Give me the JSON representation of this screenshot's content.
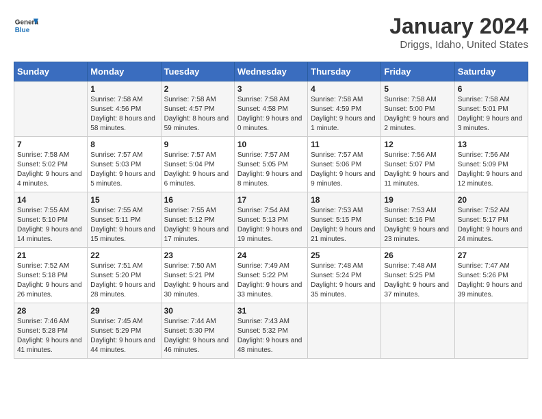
{
  "header": {
    "logo_line1": "General",
    "logo_line2": "Blue",
    "title": "January 2024",
    "subtitle": "Driggs, Idaho, United States"
  },
  "weekdays": [
    "Sunday",
    "Monday",
    "Tuesday",
    "Wednesday",
    "Thursday",
    "Friday",
    "Saturday"
  ],
  "weeks": [
    [
      {
        "day": "",
        "sunrise": "",
        "sunset": "",
        "daylight": ""
      },
      {
        "day": "1",
        "sunrise": "Sunrise: 7:58 AM",
        "sunset": "Sunset: 4:56 PM",
        "daylight": "Daylight: 8 hours and 58 minutes."
      },
      {
        "day": "2",
        "sunrise": "Sunrise: 7:58 AM",
        "sunset": "Sunset: 4:57 PM",
        "daylight": "Daylight: 8 hours and 59 minutes."
      },
      {
        "day": "3",
        "sunrise": "Sunrise: 7:58 AM",
        "sunset": "Sunset: 4:58 PM",
        "daylight": "Daylight: 9 hours and 0 minutes."
      },
      {
        "day": "4",
        "sunrise": "Sunrise: 7:58 AM",
        "sunset": "Sunset: 4:59 PM",
        "daylight": "Daylight: 9 hours and 1 minute."
      },
      {
        "day": "5",
        "sunrise": "Sunrise: 7:58 AM",
        "sunset": "Sunset: 5:00 PM",
        "daylight": "Daylight: 9 hours and 2 minutes."
      },
      {
        "day": "6",
        "sunrise": "Sunrise: 7:58 AM",
        "sunset": "Sunset: 5:01 PM",
        "daylight": "Daylight: 9 hours and 3 minutes."
      }
    ],
    [
      {
        "day": "7",
        "sunrise": "Sunrise: 7:58 AM",
        "sunset": "Sunset: 5:02 PM",
        "daylight": "Daylight: 9 hours and 4 minutes."
      },
      {
        "day": "8",
        "sunrise": "Sunrise: 7:57 AM",
        "sunset": "Sunset: 5:03 PM",
        "daylight": "Daylight: 9 hours and 5 minutes."
      },
      {
        "day": "9",
        "sunrise": "Sunrise: 7:57 AM",
        "sunset": "Sunset: 5:04 PM",
        "daylight": "Daylight: 9 hours and 6 minutes."
      },
      {
        "day": "10",
        "sunrise": "Sunrise: 7:57 AM",
        "sunset": "Sunset: 5:05 PM",
        "daylight": "Daylight: 9 hours and 8 minutes."
      },
      {
        "day": "11",
        "sunrise": "Sunrise: 7:57 AM",
        "sunset": "Sunset: 5:06 PM",
        "daylight": "Daylight: 9 hours and 9 minutes."
      },
      {
        "day": "12",
        "sunrise": "Sunrise: 7:56 AM",
        "sunset": "Sunset: 5:07 PM",
        "daylight": "Daylight: 9 hours and 11 minutes."
      },
      {
        "day": "13",
        "sunrise": "Sunrise: 7:56 AM",
        "sunset": "Sunset: 5:09 PM",
        "daylight": "Daylight: 9 hours and 12 minutes."
      }
    ],
    [
      {
        "day": "14",
        "sunrise": "Sunrise: 7:55 AM",
        "sunset": "Sunset: 5:10 PM",
        "daylight": "Daylight: 9 hours and 14 minutes."
      },
      {
        "day": "15",
        "sunrise": "Sunrise: 7:55 AM",
        "sunset": "Sunset: 5:11 PM",
        "daylight": "Daylight: 9 hours and 15 minutes."
      },
      {
        "day": "16",
        "sunrise": "Sunrise: 7:55 AM",
        "sunset": "Sunset: 5:12 PM",
        "daylight": "Daylight: 9 hours and 17 minutes."
      },
      {
        "day": "17",
        "sunrise": "Sunrise: 7:54 AM",
        "sunset": "Sunset: 5:13 PM",
        "daylight": "Daylight: 9 hours and 19 minutes."
      },
      {
        "day": "18",
        "sunrise": "Sunrise: 7:53 AM",
        "sunset": "Sunset: 5:15 PM",
        "daylight": "Daylight: 9 hours and 21 minutes."
      },
      {
        "day": "19",
        "sunrise": "Sunrise: 7:53 AM",
        "sunset": "Sunset: 5:16 PM",
        "daylight": "Daylight: 9 hours and 23 minutes."
      },
      {
        "day": "20",
        "sunrise": "Sunrise: 7:52 AM",
        "sunset": "Sunset: 5:17 PM",
        "daylight": "Daylight: 9 hours and 24 minutes."
      }
    ],
    [
      {
        "day": "21",
        "sunrise": "Sunrise: 7:52 AM",
        "sunset": "Sunset: 5:18 PM",
        "daylight": "Daylight: 9 hours and 26 minutes."
      },
      {
        "day": "22",
        "sunrise": "Sunrise: 7:51 AM",
        "sunset": "Sunset: 5:20 PM",
        "daylight": "Daylight: 9 hours and 28 minutes."
      },
      {
        "day": "23",
        "sunrise": "Sunrise: 7:50 AM",
        "sunset": "Sunset: 5:21 PM",
        "daylight": "Daylight: 9 hours and 30 minutes."
      },
      {
        "day": "24",
        "sunrise": "Sunrise: 7:49 AM",
        "sunset": "Sunset: 5:22 PM",
        "daylight": "Daylight: 9 hours and 33 minutes."
      },
      {
        "day": "25",
        "sunrise": "Sunrise: 7:48 AM",
        "sunset": "Sunset: 5:24 PM",
        "daylight": "Daylight: 9 hours and 35 minutes."
      },
      {
        "day": "26",
        "sunrise": "Sunrise: 7:48 AM",
        "sunset": "Sunset: 5:25 PM",
        "daylight": "Daylight: 9 hours and 37 minutes."
      },
      {
        "day": "27",
        "sunrise": "Sunrise: 7:47 AM",
        "sunset": "Sunset: 5:26 PM",
        "daylight": "Daylight: 9 hours and 39 minutes."
      }
    ],
    [
      {
        "day": "28",
        "sunrise": "Sunrise: 7:46 AM",
        "sunset": "Sunset: 5:28 PM",
        "daylight": "Daylight: 9 hours and 41 minutes."
      },
      {
        "day": "29",
        "sunrise": "Sunrise: 7:45 AM",
        "sunset": "Sunset: 5:29 PM",
        "daylight": "Daylight: 9 hours and 44 minutes."
      },
      {
        "day": "30",
        "sunrise": "Sunrise: 7:44 AM",
        "sunset": "Sunset: 5:30 PM",
        "daylight": "Daylight: 9 hours and 46 minutes."
      },
      {
        "day": "31",
        "sunrise": "Sunrise: 7:43 AM",
        "sunset": "Sunset: 5:32 PM",
        "daylight": "Daylight: 9 hours and 48 minutes."
      },
      {
        "day": "",
        "sunrise": "",
        "sunset": "",
        "daylight": ""
      },
      {
        "day": "",
        "sunrise": "",
        "sunset": "",
        "daylight": ""
      },
      {
        "day": "",
        "sunrise": "",
        "sunset": "",
        "daylight": ""
      }
    ]
  ]
}
